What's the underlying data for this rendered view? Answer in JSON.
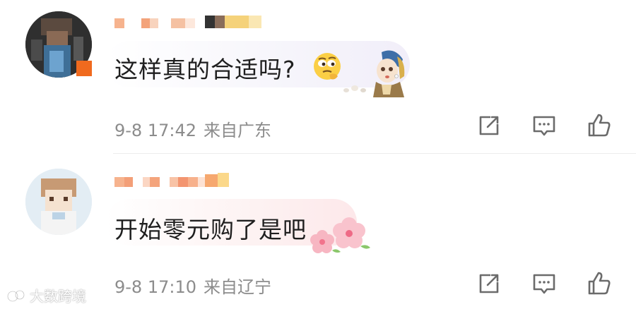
{
  "comments": [
    {
      "text": "这样真的合适吗?",
      "date": "9-8 17:42",
      "location": "来自广东",
      "emojis": [
        "thinking-face-emoji",
        "girl-with-pearl-earring-sticker"
      ],
      "avatar_color": "#3a3a3a"
    },
    {
      "text": "开始零元购了是吧",
      "date": "9-8 17:10",
      "location": "来自辽宁",
      "emojis": [
        "cherry-blossom-emoji"
      ],
      "avatar_color": "#dfe8f0"
    }
  ],
  "action_icons": [
    "share-icon",
    "comment-icon",
    "like-icon"
  ],
  "watermark": "大数跨境",
  "colors": {
    "text": "#1f1f1f",
    "meta": "#8c8c8c",
    "divider": "#ececec",
    "icon": "#6b6b6b"
  }
}
